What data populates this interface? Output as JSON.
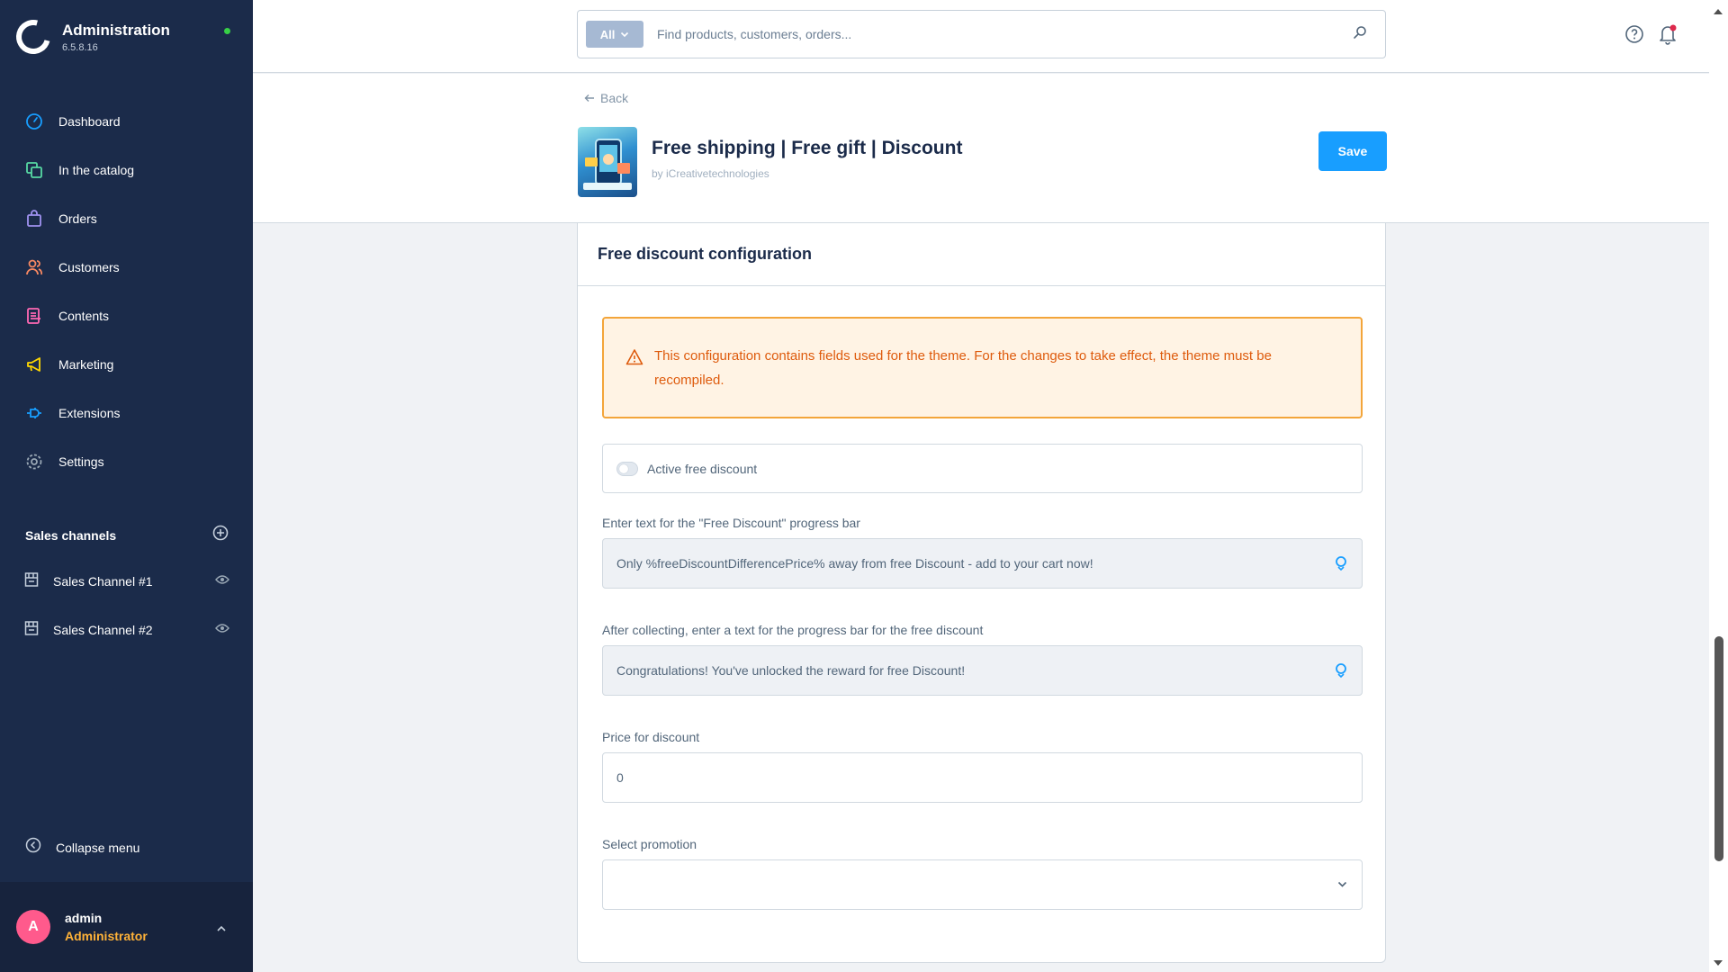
{
  "sidebar": {
    "brand_title": "Administration",
    "version": "6.5.8.16",
    "items": [
      {
        "label": "Dashboard",
        "icon": "dashboard-icon",
        "color": "#189eff"
      },
      {
        "label": "In the catalog",
        "icon": "catalog-icon",
        "color": "#57d9a3"
      },
      {
        "label": "Orders",
        "icon": "orders-bag-icon",
        "color": "#a092f0"
      },
      {
        "label": "Customers",
        "icon": "customers-icon",
        "color": "#f88962"
      },
      {
        "label": "Contents",
        "icon": "contents-icon",
        "color": "#ff68b4"
      },
      {
        "label": "Marketing",
        "icon": "marketing-megaphone-icon",
        "color": "#ffd700"
      },
      {
        "label": "Extensions",
        "icon": "extensions-plug-icon",
        "color": "#189eff"
      },
      {
        "label": "Settings",
        "icon": "settings-gear-icon",
        "color": "#9aa8b5"
      }
    ],
    "sales_channels_title": "Sales channels",
    "channels": [
      {
        "label": "Sales Channel #1"
      },
      {
        "label": "Sales Channel #2"
      }
    ],
    "collapse_label": "Collapse menu",
    "user": {
      "initial": "A",
      "name": "admin",
      "role": "Administrator"
    }
  },
  "topbar": {
    "search_type": "All",
    "search_placeholder": "Find products, customers, orders..."
  },
  "header": {
    "back_label": "Back",
    "extension_title": "Free shipping | Free gift | Discount",
    "extension_by": "by iCreativetechnologies",
    "save_label": "Save"
  },
  "card": {
    "title": "Free discount configuration",
    "alert_text": "This configuration contains fields used for the theme. For the changes to take effect, the theme must be recompiled.",
    "toggle_label": "Active free discount",
    "toggle_on": false,
    "fields": [
      {
        "label": "Enter text for the \"Free Discount\" progress bar",
        "value": "Only %freeDiscountDifferencePrice% away from free Discount - add to your cart now!"
      },
      {
        "label": "After collecting, enter a text for the progress bar for the free discount",
        "value": "Congratulations! You've unlocked the reward for free Discount!"
      },
      {
        "label": "Price for discount",
        "value": "0"
      },
      {
        "label": "Select promotion",
        "value": ""
      }
    ]
  },
  "colors": {
    "sidebar_bg": "#1b2b4a",
    "accent": "#189eff",
    "warning_border": "#f3a53a",
    "warning_text": "#de5b0d",
    "role_text": "#ffb238",
    "avatar_bg": "#ff5a8c",
    "status_online": "#37d046"
  }
}
